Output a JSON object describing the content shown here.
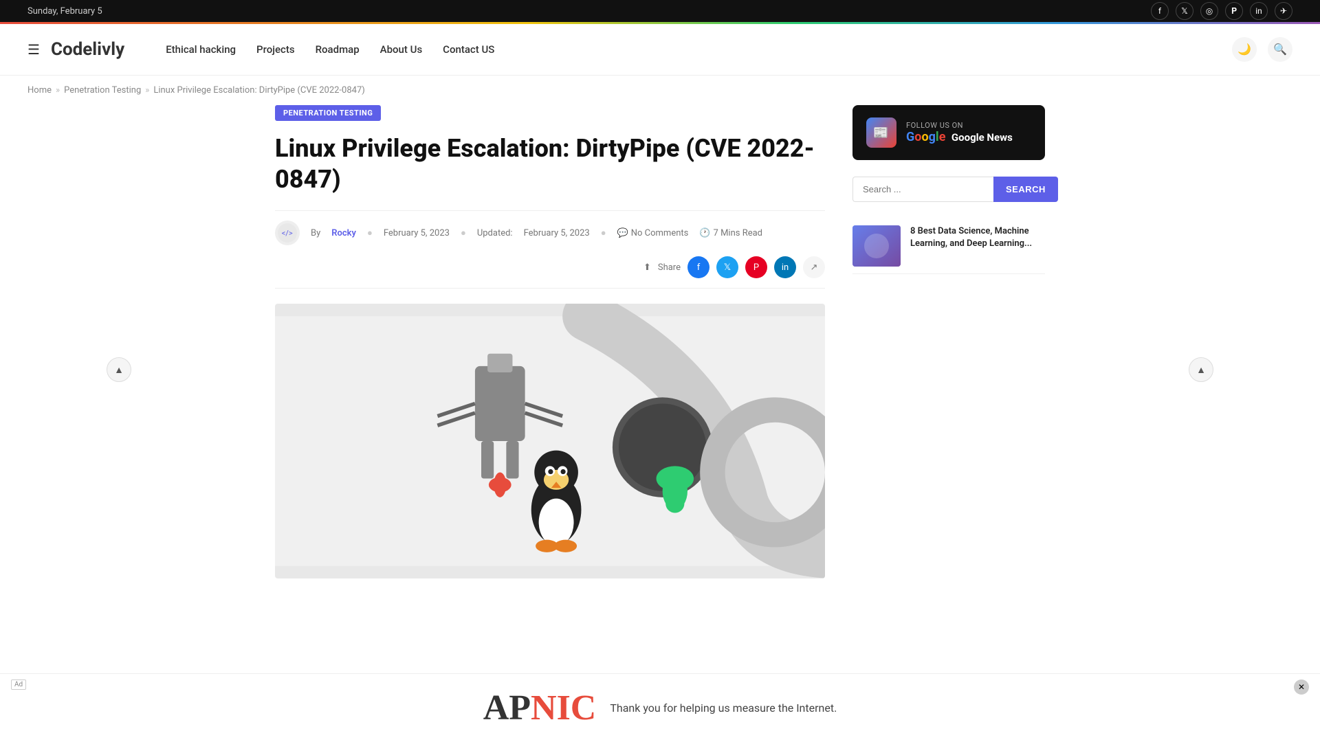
{
  "topbar": {
    "date": "Sunday, February 5"
  },
  "header": {
    "logo": "Codelivly",
    "nav": [
      {
        "label": "Ethical hacking",
        "href": "#"
      },
      {
        "label": "Projects",
        "href": "#"
      },
      {
        "label": "Roadmap",
        "href": "#"
      },
      {
        "label": "About Us",
        "href": "#"
      },
      {
        "label": "Contact US",
        "href": "#"
      }
    ]
  },
  "breadcrumb": {
    "home": "Home",
    "category": "Penetration Testing",
    "current": "Linux Privilege Escalation: DirtyPipe (CVE 2022-0847)"
  },
  "article": {
    "category_badge": "PENETRATION TESTING",
    "title": "Linux Privilege Escalation: DirtyPipe (CVE 2022-0847)",
    "author": "Rocky",
    "date": "February 5, 2023",
    "updated_label": "Updated:",
    "updated_date": "February 5, 2023",
    "comments": "No Comments",
    "read_time": "7 Mins Read",
    "share_label": "Share"
  },
  "sidebar": {
    "google_news": {
      "follow_label": "FOLLOW US ON",
      "name": "Google News"
    },
    "search_placeholder": "Search ...",
    "search_button": "SEARCH",
    "related_article": {
      "title": "8 Best Data Science, Machine Learning, and Deep Learning..."
    }
  },
  "ad": {
    "logo_text": "APNIC",
    "message": "Thank you for helping us measure the Internet."
  }
}
